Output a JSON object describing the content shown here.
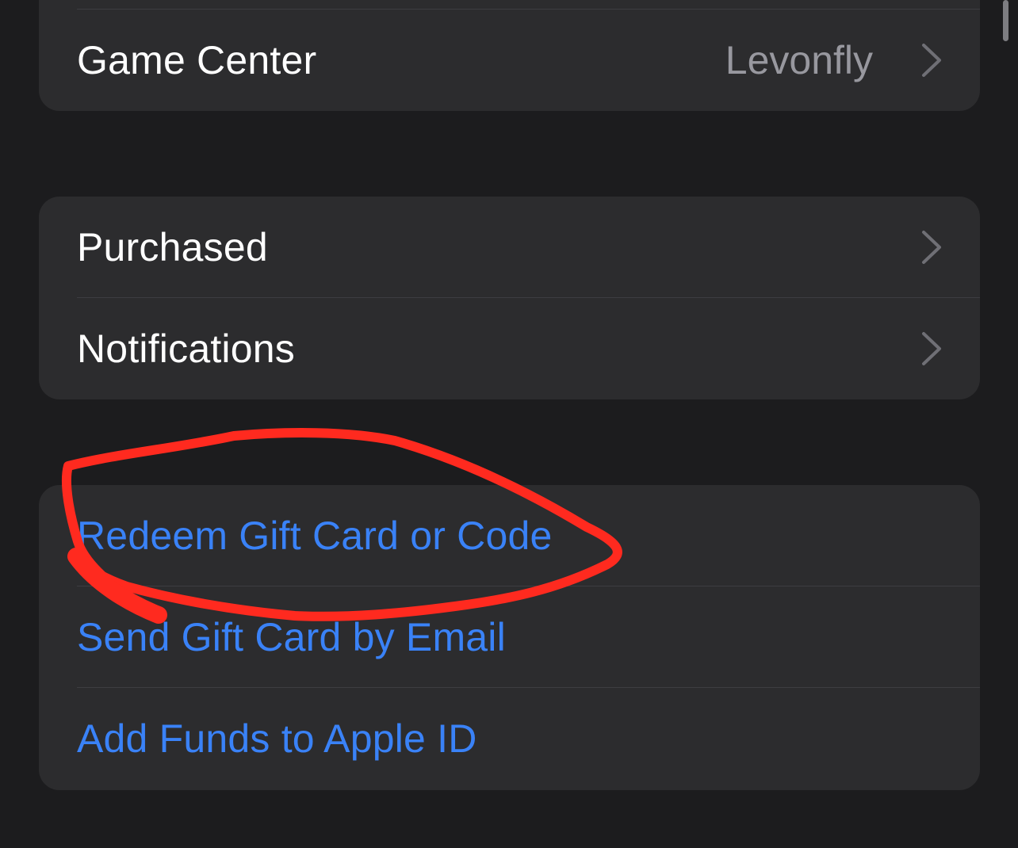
{
  "settings": {
    "game_center": {
      "label": "Game Center",
      "value": "Levonfly"
    },
    "purchased": {
      "label": "Purchased"
    },
    "notifications": {
      "label": "Notifications"
    },
    "redeem": {
      "label": "Redeem Gift Card or Code"
    },
    "send_gift": {
      "label": "Send Gift Card by Email"
    },
    "add_funds": {
      "label": "Add Funds to Apple ID"
    }
  },
  "colors": {
    "background": "#1c1c1e",
    "cell": "#2c2c2e",
    "link": "#3a82f7",
    "annotation": "#ff2a1f"
  },
  "icons": {
    "row_disclosure": "chevron-right-icon"
  }
}
